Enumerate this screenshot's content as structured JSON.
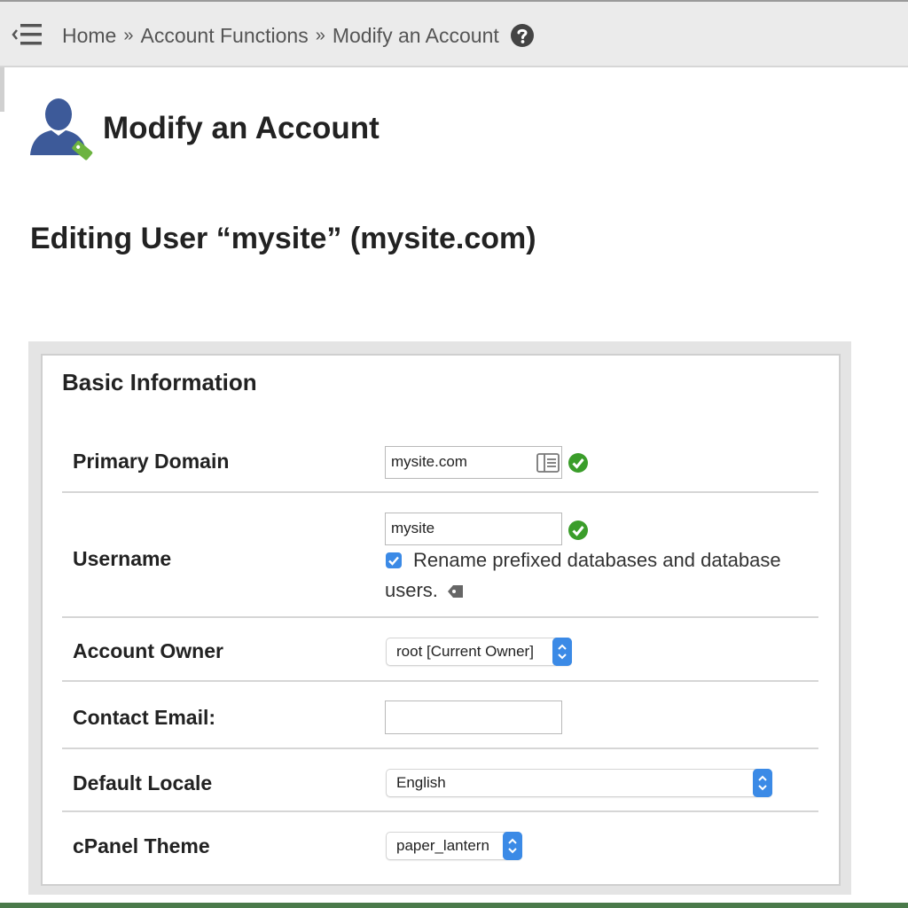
{
  "breadcrumb": {
    "items": [
      "Home",
      "Account Functions",
      "Modify an Account"
    ],
    "separator": "»"
  },
  "header": {
    "title": "Modify an Account"
  },
  "editing_title": "Editing User “mysite” (mysite.com)",
  "form": {
    "section_title": "Basic Information",
    "primary_domain": {
      "label": "Primary Domain",
      "value": "mysite.com"
    },
    "username": {
      "label": "Username",
      "value": "mysite",
      "rename_checkbox_checked": true,
      "rename_text_line1": "Rename prefixed databases and database",
      "rename_text_line2": "users."
    },
    "account_owner": {
      "label": "Account Owner",
      "selected": "root [Current Owner]"
    },
    "contact_email": {
      "label": "Contact Email:",
      "value": ""
    },
    "default_locale": {
      "label": "Default Locale",
      "selected": "English"
    },
    "cpanel_theme": {
      "label": "cPanel Theme",
      "selected": "paper_lantern"
    }
  },
  "icons": {
    "menu": "menu-toggle-icon",
    "help": "help-icon",
    "account": "user-account-icon",
    "valid": "check-circle-icon",
    "domain_picker": "domain-list-icon",
    "tag": "tag-icon"
  },
  "colors": {
    "valid_green": "#3a9d2a",
    "select_blue": "#3b8ae6",
    "user_icon_blue": "#3d5a99",
    "tag_green": "#6cb33f"
  }
}
